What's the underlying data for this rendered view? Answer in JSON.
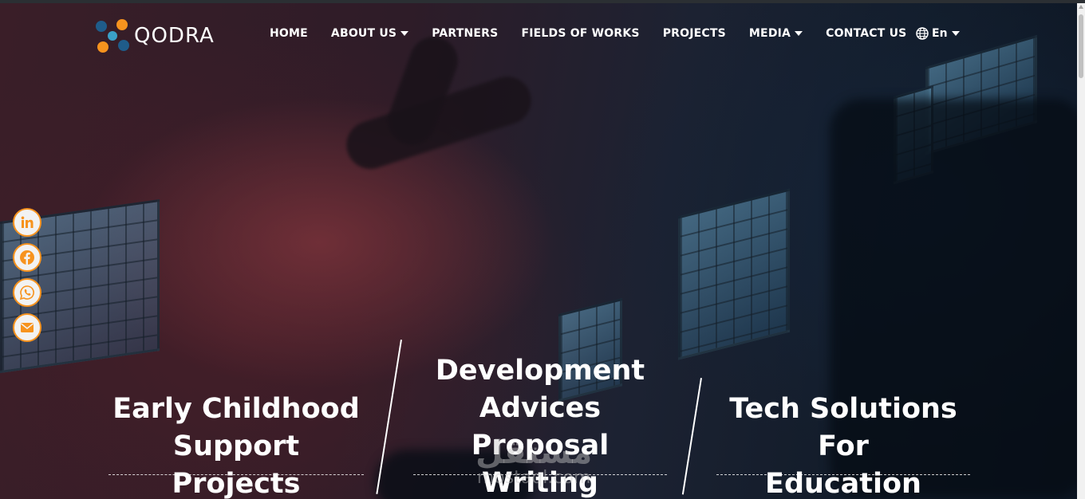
{
  "brand": {
    "name": "QODRA",
    "colors": {
      "orange": "#f7931e",
      "blue": "#1f5c8a",
      "teal": "#3aa0c8"
    }
  },
  "nav": {
    "items": [
      {
        "label": "HOME",
        "has_dropdown": false
      },
      {
        "label": "ABOUT US",
        "has_dropdown": true
      },
      {
        "label": "PARTNERS",
        "has_dropdown": false
      },
      {
        "label": "FIELDS OF WORKS",
        "has_dropdown": false
      },
      {
        "label": "PROJECTS",
        "has_dropdown": false
      },
      {
        "label": "MEDIA",
        "has_dropdown": true
      },
      {
        "label": "CONTACT US",
        "has_dropdown": false
      }
    ],
    "language": {
      "label": "En",
      "icon": "globe-icon"
    }
  },
  "social": [
    {
      "name": "linkedin",
      "icon": "linkedin-icon"
    },
    {
      "name": "facebook",
      "icon": "facebook-icon"
    },
    {
      "name": "whatsapp",
      "icon": "whatsapp-icon"
    },
    {
      "name": "email",
      "icon": "email-icon"
    }
  ],
  "hero": {
    "slides": [
      {
        "line1": "Early Childhood",
        "line2": "Support Projects",
        "line3": ""
      },
      {
        "line1": "Development",
        "line2": "Advices Proposal",
        "line3": "Writing"
      },
      {
        "line1": "Tech Solutions For",
        "line2": "Education",
        "line3": ""
      }
    ]
  },
  "watermark": {
    "arabic": "مستقل",
    "latin": "mostaql.com"
  }
}
